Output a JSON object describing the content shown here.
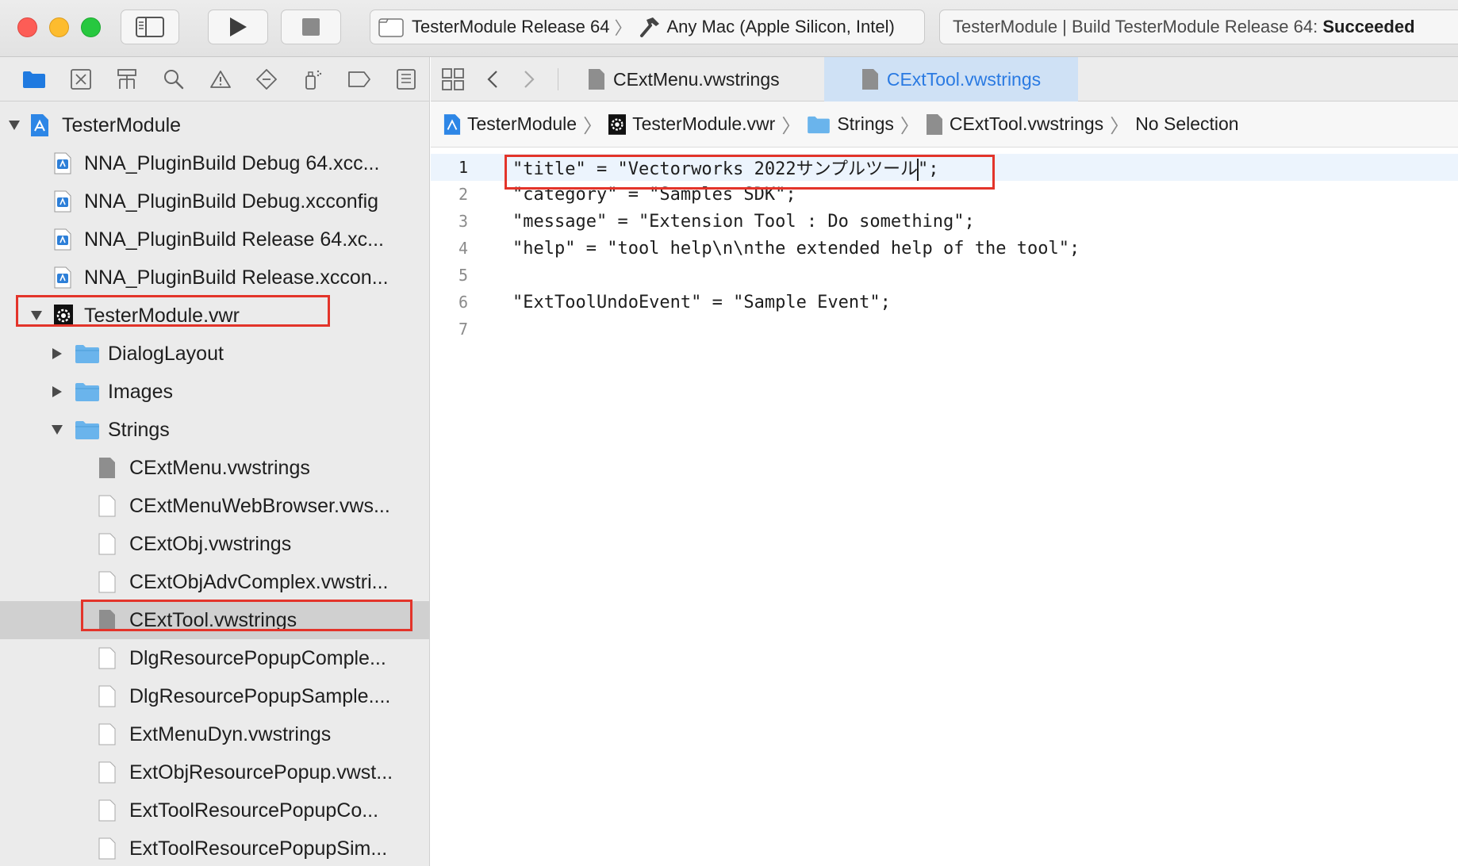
{
  "toolbar": {
    "scheme_name": "TesterModule Release 64",
    "destination": "Any Mac (Apple Silicon, Intel)",
    "status_prefix": "TesterModule | Build TesterModule Release 64: ",
    "status_result": "Succeeded"
  },
  "navigator": {
    "tree": {
      "project": "TesterModule",
      "configs": [
        "NNA_PluginBuild Debug 64.xcc...",
        "NNA_PluginBuild Debug.xcconfig",
        "NNA_PluginBuild Release 64.xc...",
        "NNA_PluginBuild Release.xccon..."
      ],
      "vwr": "TesterModule.vwr",
      "folders": [
        "DialogLayout",
        "Images",
        "Strings"
      ],
      "strings_files": [
        "CExtMenu.vwstrings",
        "CExtMenuWebBrowser.vws...",
        "CExtObj.vwstrings",
        "CExtObjAdvComplex.vwstri...",
        "CExtTool.vwstrings",
        "DlgResourcePopupComple...",
        "DlgResourcePopupSample....",
        "ExtMenuDyn.vwstrings",
        "ExtObjResourcePopup.vwst...",
        "ExtToolResourcePopupCo...",
        "ExtToolResourcePopupSim..."
      ]
    }
  },
  "editor": {
    "tabs": [
      "CExtMenu.vwstrings",
      "CExtTool.vwstrings"
    ],
    "breadcrumb": [
      "TesterModule",
      "TesterModule.vwr",
      "Strings",
      "CExtTool.vwstrings",
      "No Selection"
    ],
    "line1_before_caret": "\"title\" = \"Vectorworks 2022サンプルツール",
    "line1_after_caret": "\";",
    "lines": [
      "\"category\" = \"Samples SDK\";",
      "\"message\" = \"Extension Tool : Do something\";",
      "\"help\" = \"tool help\\n\\nthe extended help of the tool\";",
      "",
      "\"ExtToolUndoEvent\" = \"Sample Event\";",
      ""
    ],
    "line_numbers": [
      "1",
      "2",
      "3",
      "4",
      "5",
      "6",
      "7"
    ]
  }
}
